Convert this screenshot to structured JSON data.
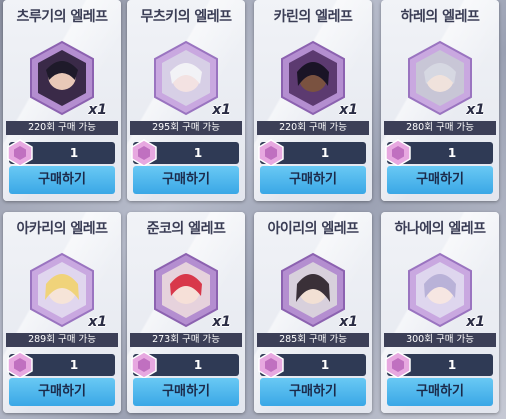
{
  "colors": {
    "card_bg": "#e8ebf1",
    "price_bar": "#2f3a55",
    "buy_button": "#3aa7e6",
    "limit_bar": "#3c3f57",
    "emblem_purple": "#b48ed0"
  },
  "items": [
    {
      "title": "츠루기의 엘레프",
      "qty": "x1",
      "limit": "220회 구매 가능",
      "price": "1",
      "buy_label": "구매하기",
      "icon": "elef-emblem-icon"
    },
    {
      "title": "무츠키의 엘레프",
      "qty": "x1",
      "limit": "295회 구매 가능",
      "price": "1",
      "buy_label": "구매하기",
      "icon": "elef-emblem-icon"
    },
    {
      "title": "카린의 엘레프",
      "qty": "x1",
      "limit": "220회 구매 가능",
      "price": "1",
      "buy_label": "구매하기",
      "icon": "elef-emblem-icon"
    },
    {
      "title": "하레의 엘레프",
      "qty": "x1",
      "limit": "280회 구매 가능",
      "price": "1",
      "buy_label": "구매하기",
      "icon": "elef-emblem-icon"
    },
    {
      "title": "아카리의 엘레프",
      "qty": "x1",
      "limit": "289회 구매 가능",
      "price": "1",
      "buy_label": "구매하기",
      "icon": "elef-emblem-icon"
    },
    {
      "title": "준코의 엘레프",
      "qty": "x1",
      "limit": "273회 구매 가능",
      "price": "1",
      "buy_label": "구매하기",
      "icon": "elef-emblem-icon"
    },
    {
      "title": "아이리의 엘레프",
      "qty": "x1",
      "limit": "285회 구매 가능",
      "price": "1",
      "buy_label": "구매하기",
      "icon": "elef-emblem-icon"
    },
    {
      "title": "하나에의 엘레프",
      "qty": "x1",
      "limit": "300회 구매 가능",
      "price": "1",
      "buy_label": "구매하기",
      "icon": "elef-emblem-icon"
    }
  ]
}
